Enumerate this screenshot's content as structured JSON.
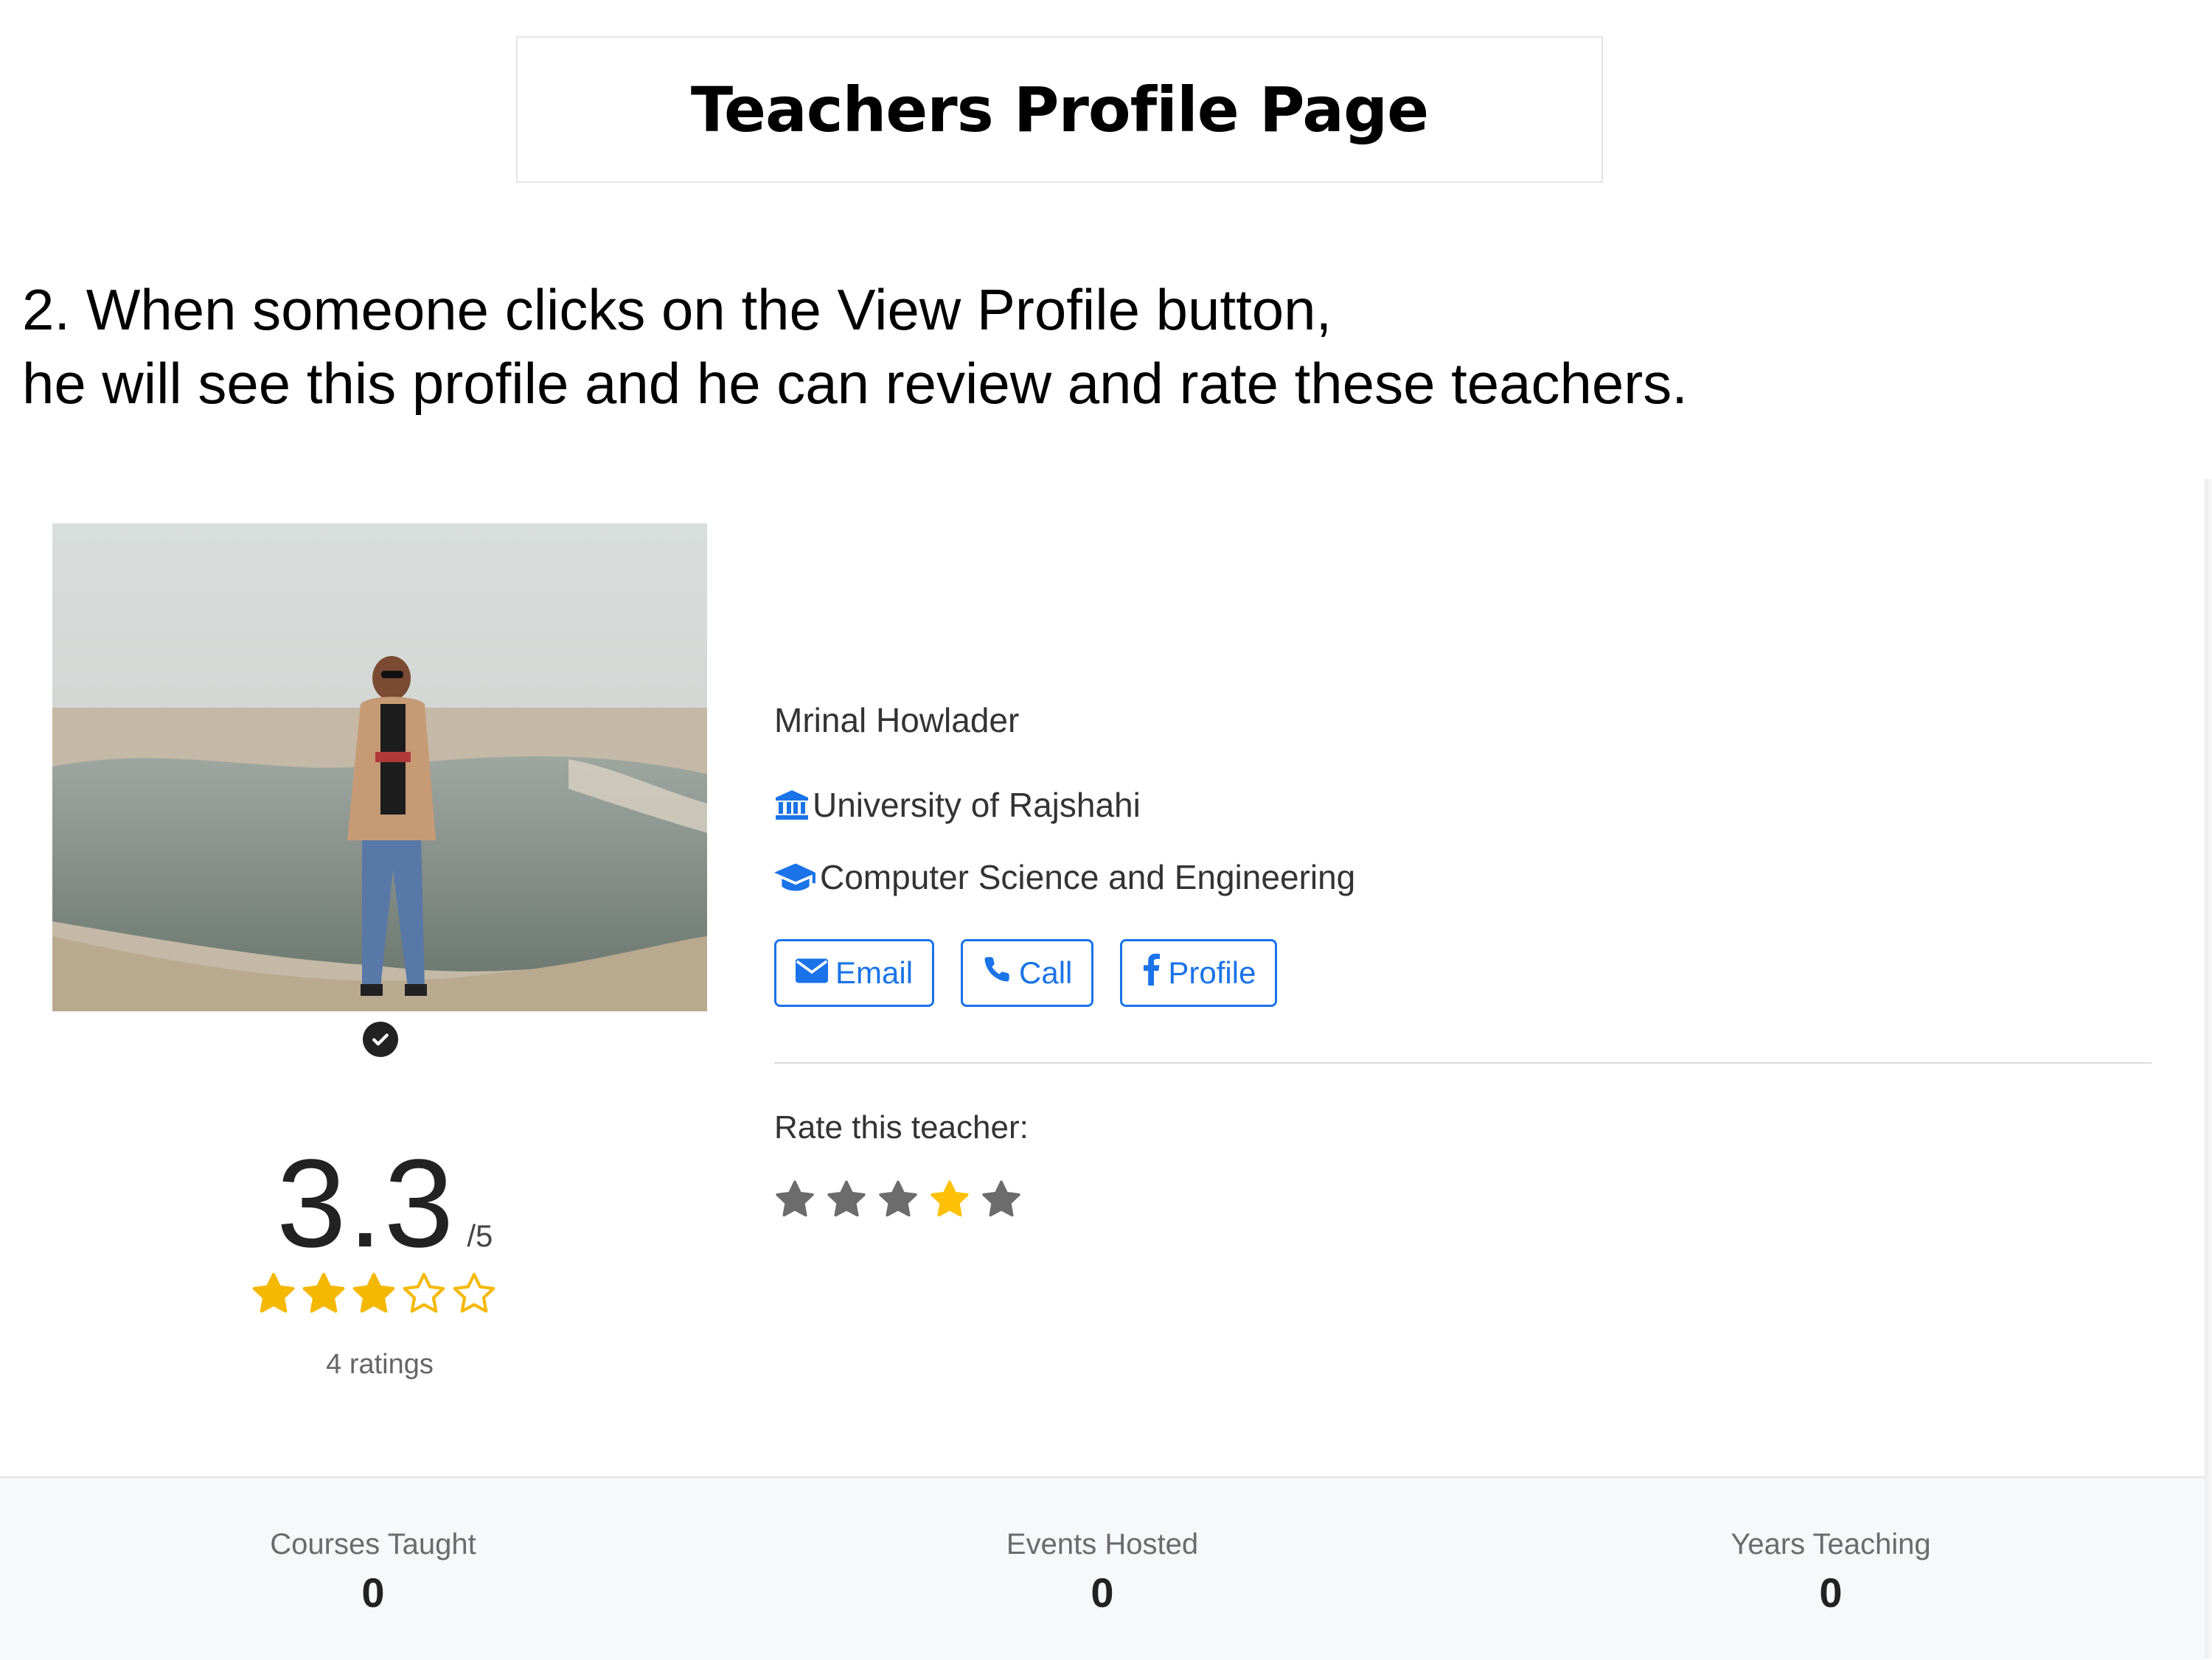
{
  "page_title": "Teachers Profile Page",
  "description": {
    "line1": "2. When someone clicks on the View Profile button,",
    "line2": "he will see this profile and he can review and rate these teachers."
  },
  "profile": {
    "photo_icon": "profile-photo",
    "verified_icon": "check-circle-icon",
    "name": "Mrinal Howlader",
    "university_icon": "university-icon",
    "university": "University of Rajshahi",
    "department_icon": "graduation-cap-icon",
    "department": "Computer Science and Engineering",
    "buttons": [
      {
        "label": "Email",
        "icon": "envelope-icon"
      },
      {
        "label": "Call",
        "icon": "phone-icon"
      },
      {
        "label": "Profile",
        "icon": "facebook-icon"
      }
    ]
  },
  "rating": {
    "value": "3.3",
    "out_of": "/5",
    "stars_filled": 3,
    "stars_total": 5,
    "count_text": "4 ratings",
    "filled_color": "#f5b800"
  },
  "rate_this": {
    "label": "Rate this teacher:",
    "highlighted_star": 4,
    "star_color": "#6c6c6c",
    "highlight_color": "#ffc107"
  },
  "stats": [
    {
      "label": "Courses Taught",
      "value": "0"
    },
    {
      "label": "Events Hosted",
      "value": "0"
    },
    {
      "label": "Years Teaching",
      "value": "0"
    }
  ],
  "colors": {
    "accent": "#1a73e8",
    "stats_background": "#f7f8fa"
  }
}
